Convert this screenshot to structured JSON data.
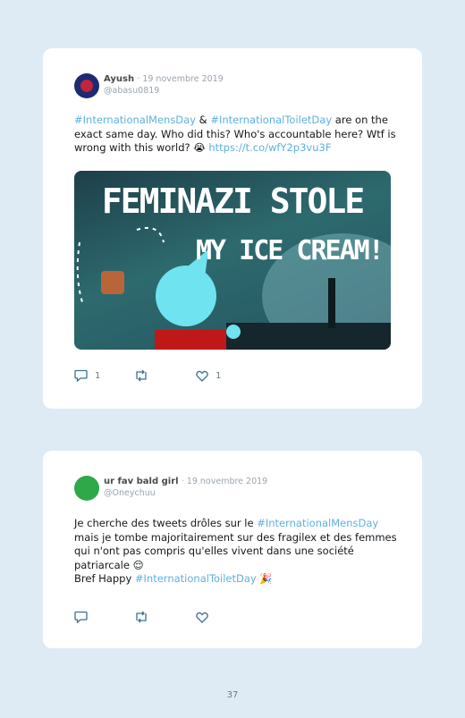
{
  "tweets": [
    {
      "name": "Ayush",
      "date": "· 19 novembre 2019",
      "handle": "@abasu0819",
      "text": {
        "tag1": "#InternationalMensDay",
        "t1": " & ",
        "tag2": "#InternationalToiletDay",
        "t2": " are on the exact same day. Who did this? Who's accountable here? Wtf is wrong with this world? ",
        "emoji": "😭",
        "link": "https://t.co/wfY2p3vu3F"
      },
      "media": {
        "line1": "FEMINAZI STOLE",
        "line2": "MY ICE CREAM!"
      },
      "actions": {
        "reply_count": "1",
        "retweet_count": "",
        "like_count": "1"
      }
    },
    {
      "name": "ur fav bald girl",
      "date": "· 19 novembre 2019",
      "handle": "@Oneychuu",
      "text": {
        "t1": "Je cherche des tweets drôles sur le ",
        "tag1": "#InternationalMensDay",
        "t2": " mais je tombe majoritairement sur des fragilex et des femmes qui n'ont pas compris qu'elles vivent dans une société patriarcale ",
        "emoji1": "😌",
        "t3": "Bref Happy ",
        "tag2": "#InternationalToiletDay",
        "emoji2": "🎉"
      },
      "actions": {
        "reply_count": "",
        "retweet_count": "",
        "like_count": ""
      }
    }
  ],
  "icons": [
    "reply-icon",
    "retweet-icon",
    "like-icon"
  ],
  "colors": {
    "background": "#deebf5",
    "hashtag": "#5eb0e0",
    "card": "#ffffff"
  },
  "page_number": "37"
}
